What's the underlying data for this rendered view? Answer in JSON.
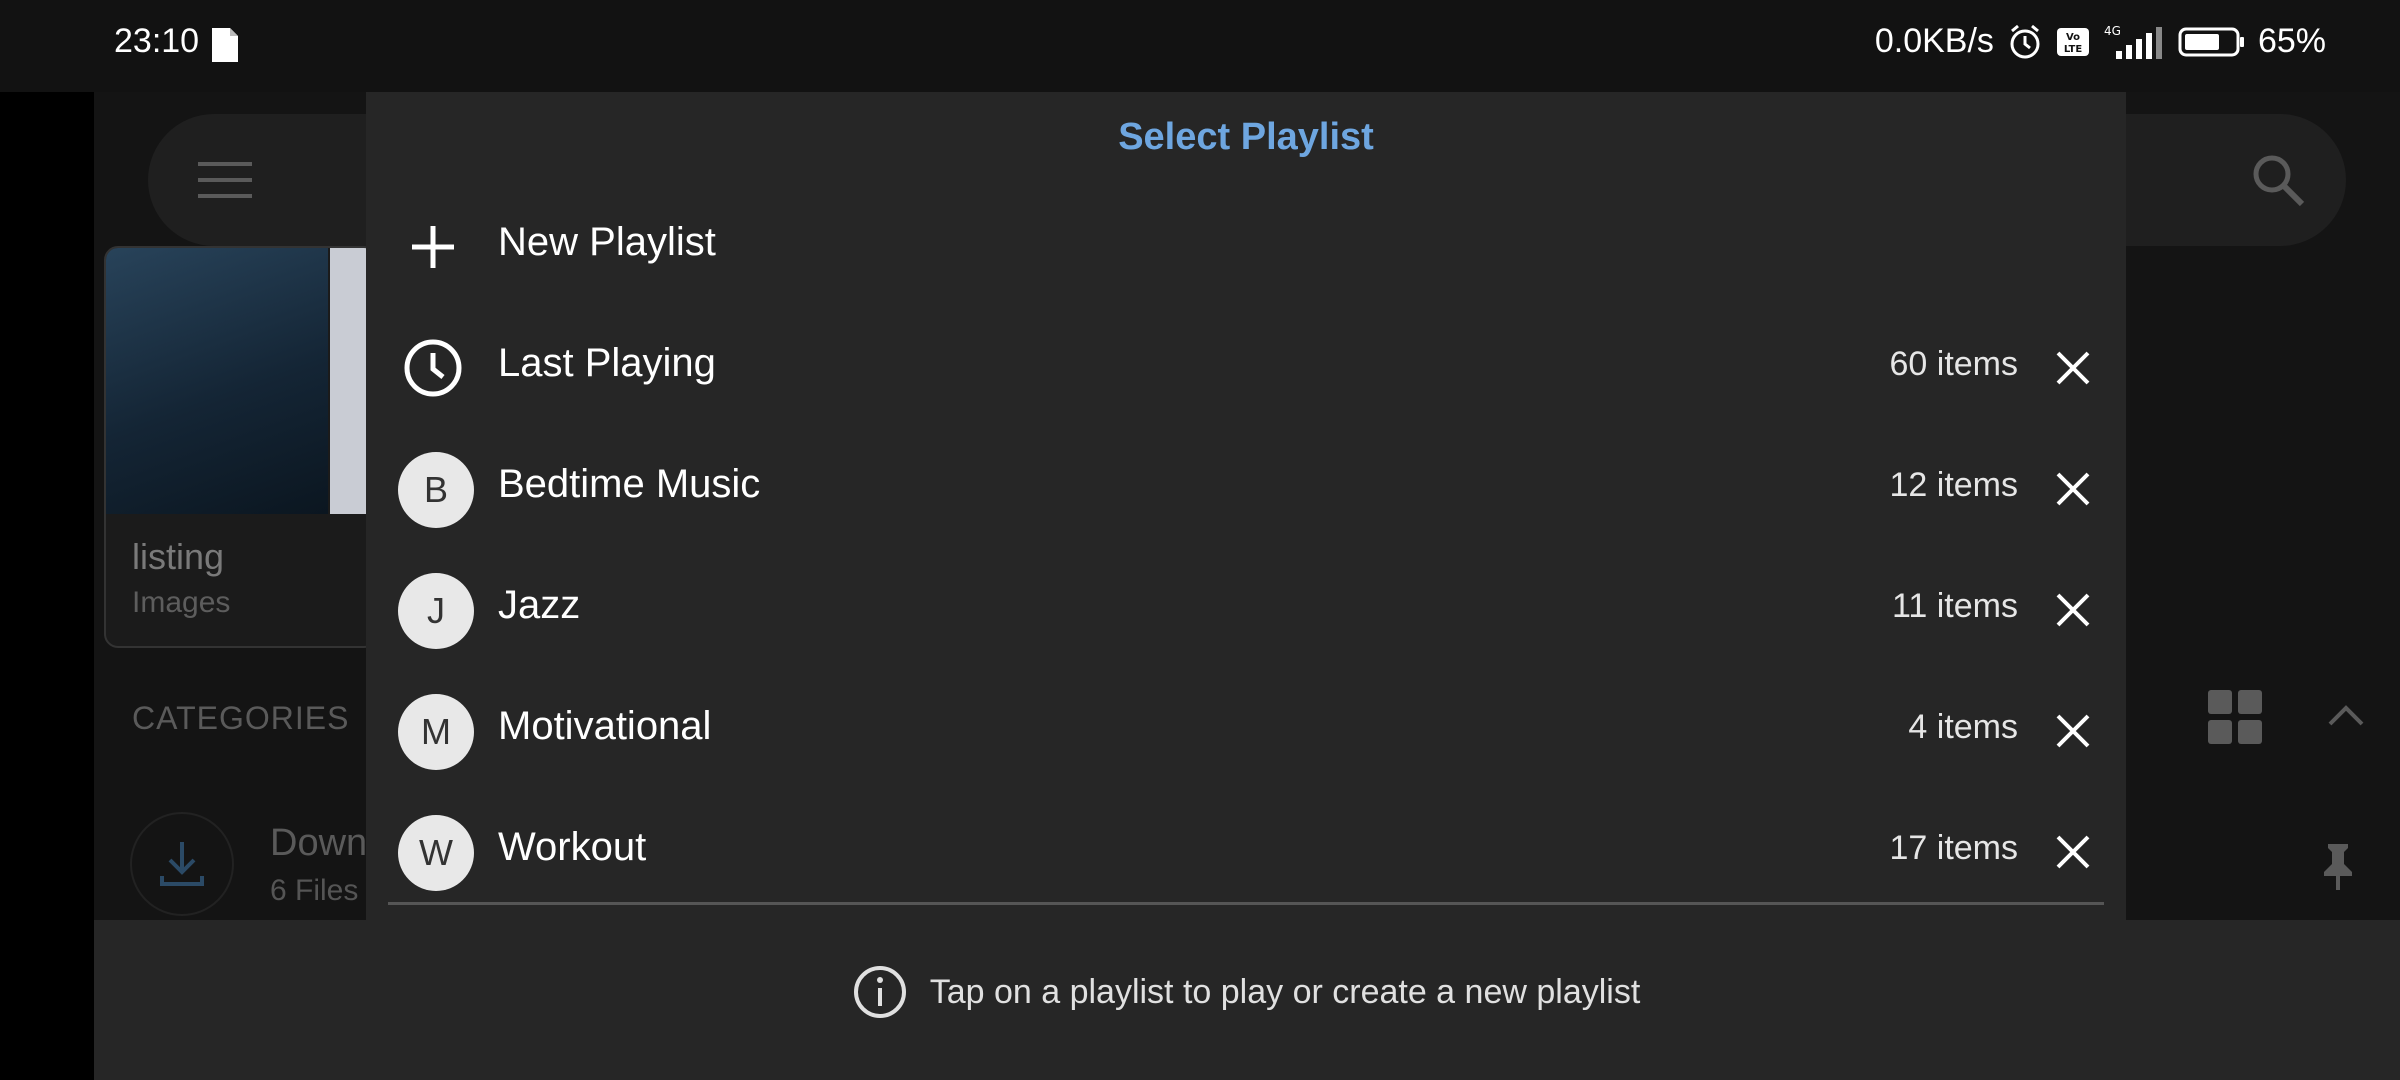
{
  "status_bar": {
    "time": "23:10",
    "network_speed": "0.0KB/s",
    "network_type": "4G",
    "volte": "Vo LTE",
    "battery": "65%",
    "icons": [
      "document-icon",
      "alarm-icon",
      "volte-icon",
      "signal-icon",
      "battery-icon"
    ]
  },
  "background": {
    "card_title": "listing",
    "card_subtitle": "Images",
    "categories_label": "CATEGORIES",
    "item_title": "Down",
    "item_subtitle": "6 Files"
  },
  "dialog": {
    "title": "Select Playlist",
    "new_playlist_label": "New Playlist",
    "playlists": [
      {
        "label": "Last Playing",
        "count": "60 items",
        "icon": "clock-icon",
        "avatar": ""
      },
      {
        "label": "Bedtime Music",
        "count": "12 items",
        "icon": "avatar",
        "avatar": "B"
      },
      {
        "label": "Jazz",
        "count": "11 items",
        "icon": "avatar",
        "avatar": "J"
      },
      {
        "label": "Motivational",
        "count": "4 items",
        "icon": "avatar",
        "avatar": "M"
      },
      {
        "label": "Workout",
        "count": "17 items",
        "icon": "avatar",
        "avatar": "W"
      }
    ],
    "hint": "Tap on a playlist to play or create a new playlist"
  },
  "colors": {
    "accent": "#6ea6e0",
    "dialog_bg": "#262626",
    "avatar_bg": "#e8e8e8"
  }
}
